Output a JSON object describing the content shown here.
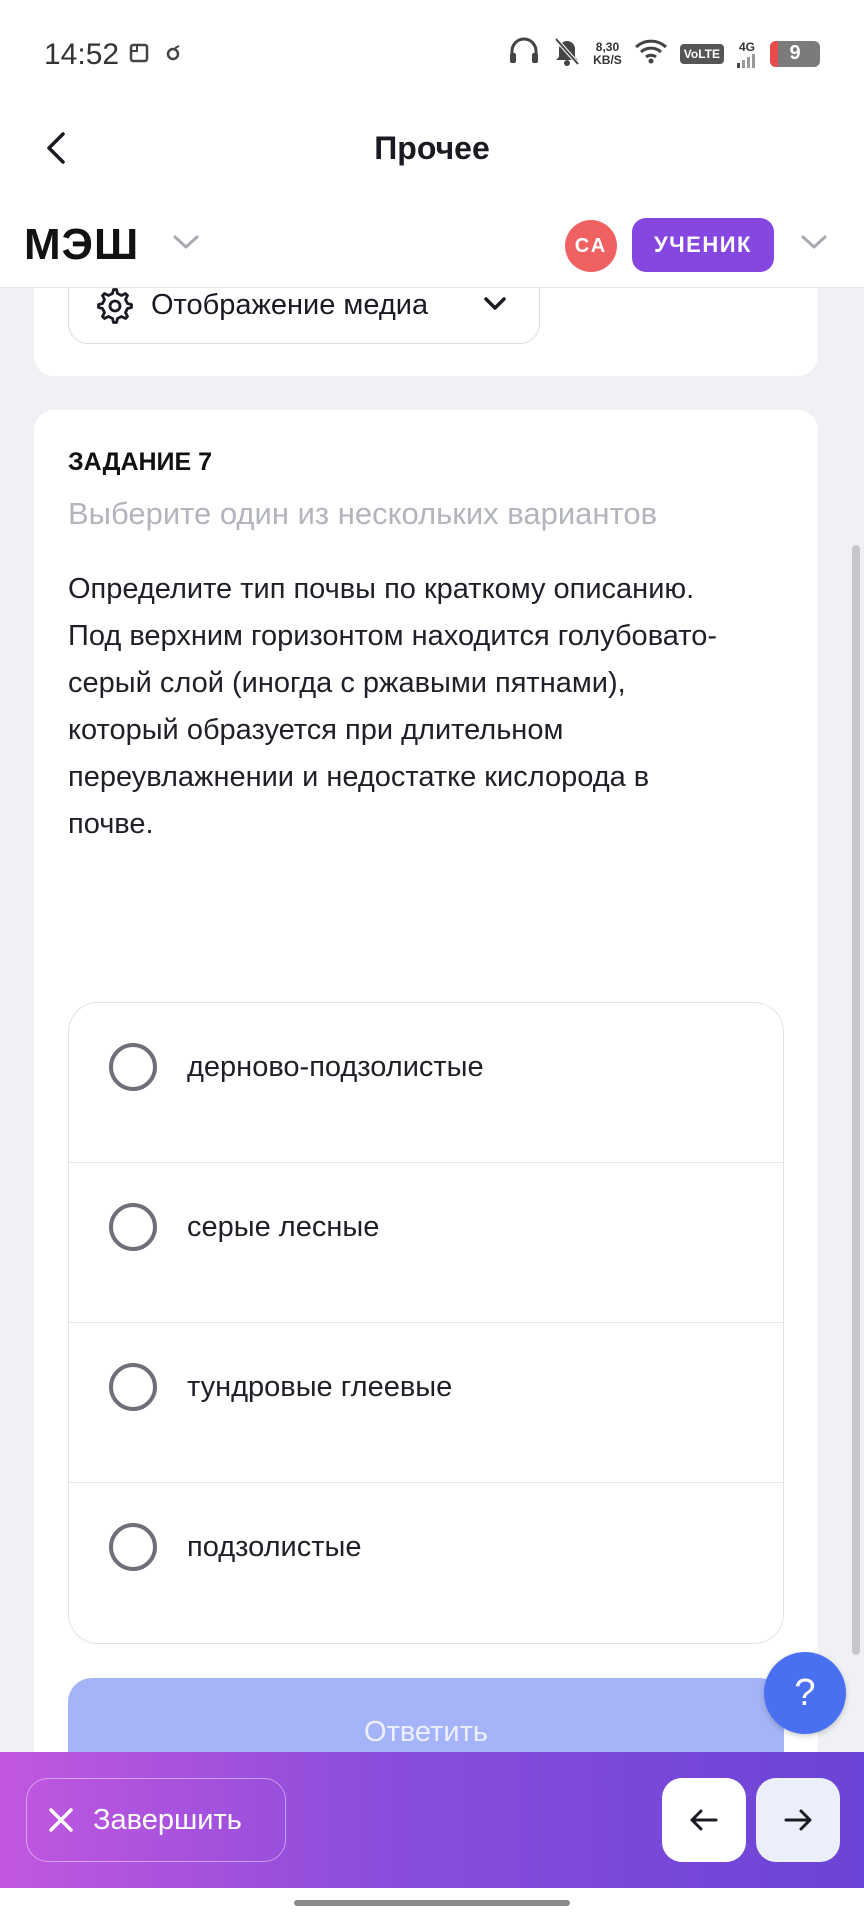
{
  "status_bar": {
    "time": "14:52",
    "speed": "8,30",
    "speed_unit": "KB/S",
    "volte": "VoLTE",
    "network": "4G",
    "battery": "9"
  },
  "header": {
    "title": "Прочее",
    "back_icon": "chevron-left-icon"
  },
  "brand": {
    "logo": "МЭШ",
    "avatar_initials": "СА",
    "role": "УЧЕНИК"
  },
  "media_settings": {
    "label": "Отображение медиа",
    "icon": "gear-icon"
  },
  "task": {
    "number": "ЗАДАНИЕ 7",
    "hint": "Выберите один из нескольких вариантов",
    "lines": [
      "Определите тип почвы по краткому описанию.",
      "Под верхним горизонтом находится голубовато-",
      "серый слой (иногда с ржавыми пятнами),",
      "который образуется при длительном",
      "переувлажнении и недостатке кислорода в",
      "почве."
    ],
    "options": [
      {
        "label": "дерново-подзолистые",
        "selected": false
      },
      {
        "label": "серые лесные",
        "selected": false
      },
      {
        "label": "тундровые глеевые",
        "selected": false
      },
      {
        "label": "подзолистые",
        "selected": false
      }
    ],
    "answer_label": "Ответить"
  },
  "help": {
    "label": "?"
  },
  "bottom_bar": {
    "finish_label": "Завершить",
    "prev_icon": "arrow-left-icon",
    "next_icon": "arrow-right-icon"
  },
  "colors": {
    "accent": "#8547e0",
    "avatar": "#f06262",
    "answer_disabled": "#a5b4f8",
    "help": "#4a70f2",
    "gradient_start": "#c257e0",
    "gradient_end": "#6a44d6"
  }
}
